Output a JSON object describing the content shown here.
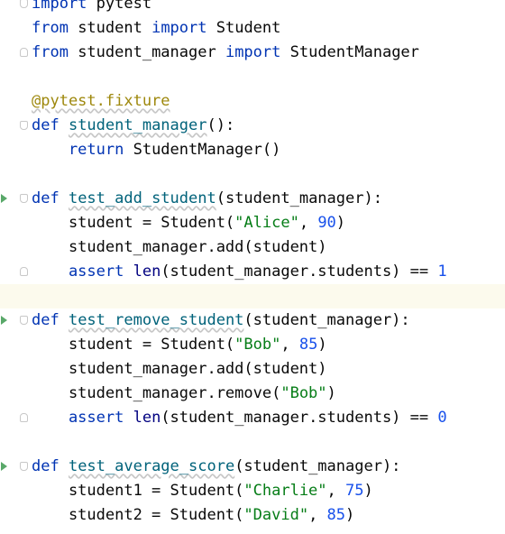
{
  "editor": {
    "lines": [
      {
        "tokens": [
          {
            "t": "import ",
            "c": "k"
          },
          {
            "t": "pytest",
            "c": "n"
          }
        ]
      },
      {
        "tokens": [
          {
            "t": "from ",
            "c": "k"
          },
          {
            "t": "student ",
            "c": "n"
          },
          {
            "t": "import ",
            "c": "k"
          },
          {
            "t": "Student",
            "c": "n"
          }
        ]
      },
      {
        "tokens": [
          {
            "t": "from ",
            "c": "k"
          },
          {
            "t": "student_manager ",
            "c": "n"
          },
          {
            "t": "import ",
            "c": "k"
          },
          {
            "t": "StudentManager",
            "c": "n"
          }
        ]
      },
      {
        "tokens": []
      },
      {
        "tokens": [
          {
            "t": "@pytest.fixture",
            "c": "d"
          }
        ]
      },
      {
        "tokens": [
          {
            "t": "def ",
            "c": "k"
          },
          {
            "t": "student_manager",
            "c": "f"
          },
          {
            "t": "():",
            "c": "n"
          }
        ]
      },
      {
        "tokens": [
          {
            "t": "    return ",
            "c": "k"
          },
          {
            "t": "StudentManager()",
            "c": "n"
          }
        ]
      },
      {
        "tokens": []
      },
      {
        "tokens": [
          {
            "t": "def ",
            "c": "k"
          },
          {
            "t": "test_add_student",
            "c": "f"
          },
          {
            "t": "(student_manager):",
            "c": "n"
          }
        ]
      },
      {
        "tokens": [
          {
            "t": "    student = Student(",
            "c": "n"
          },
          {
            "t": "\"Alice\"",
            "c": "s"
          },
          {
            "t": ", ",
            "c": "n"
          },
          {
            "t": "90",
            "c": "num"
          },
          {
            "t": ")",
            "c": "n"
          }
        ]
      },
      {
        "tokens": [
          {
            "t": "    student_manager.add(student)",
            "c": "n"
          }
        ]
      },
      {
        "tokens": [
          {
            "t": "    assert ",
            "c": "k"
          },
          {
            "t": "len",
            "c": "b"
          },
          {
            "t": "(student_manager.students) == ",
            "c": "n"
          },
          {
            "t": "1",
            "c": "num"
          }
        ]
      },
      {
        "tokens": []
      },
      {
        "tokens": [
          {
            "t": "def ",
            "c": "k"
          },
          {
            "t": "test_remove_student",
            "c": "f"
          },
          {
            "t": "(student_manager):",
            "c": "n"
          }
        ]
      },
      {
        "tokens": [
          {
            "t": "    student = Student(",
            "c": "n"
          },
          {
            "t": "\"Bob\"",
            "c": "s"
          },
          {
            "t": ", ",
            "c": "n"
          },
          {
            "t": "85",
            "c": "num"
          },
          {
            "t": ")",
            "c": "n"
          }
        ]
      },
      {
        "tokens": [
          {
            "t": "    student_manager.add(student)",
            "c": "n"
          }
        ]
      },
      {
        "tokens": [
          {
            "t": "    student_manager.remove(",
            "c": "n"
          },
          {
            "t": "\"Bob\"",
            "c": "s"
          },
          {
            "t": ")",
            "c": "n"
          }
        ]
      },
      {
        "tokens": [
          {
            "t": "    assert ",
            "c": "k"
          },
          {
            "t": "len",
            "c": "b"
          },
          {
            "t": "(student_manager.students) == ",
            "c": "n"
          },
          {
            "t": "0",
            "c": "num"
          }
        ]
      },
      {
        "tokens": []
      },
      {
        "tokens": [
          {
            "t": "def ",
            "c": "k"
          },
          {
            "t": "test_average_score",
            "c": "f"
          },
          {
            "t": "(student_manager):",
            "c": "n"
          }
        ]
      },
      {
        "tokens": [
          {
            "t": "    student1 = Student(",
            "c": "n"
          },
          {
            "t": "\"Charlie\"",
            "c": "s"
          },
          {
            "t": ", ",
            "c": "n"
          },
          {
            "t": "75",
            "c": "num"
          },
          {
            "t": ")",
            "c": "n"
          }
        ]
      },
      {
        "tokens": [
          {
            "t": "    student2 = Student(",
            "c": "n"
          },
          {
            "t": "\"David\"",
            "c": "s"
          },
          {
            "t": ", ",
            "c": "n"
          },
          {
            "t": "85",
            "c": "num"
          },
          {
            "t": ")",
            "c": "n"
          }
        ]
      }
    ],
    "caret_line": 13,
    "run_gutter_lines": [
      9,
      14,
      20
    ],
    "fold_start_lines": [
      1,
      6,
      9,
      14,
      20
    ],
    "fold_end_lines": [
      3,
      12,
      18
    ]
  }
}
